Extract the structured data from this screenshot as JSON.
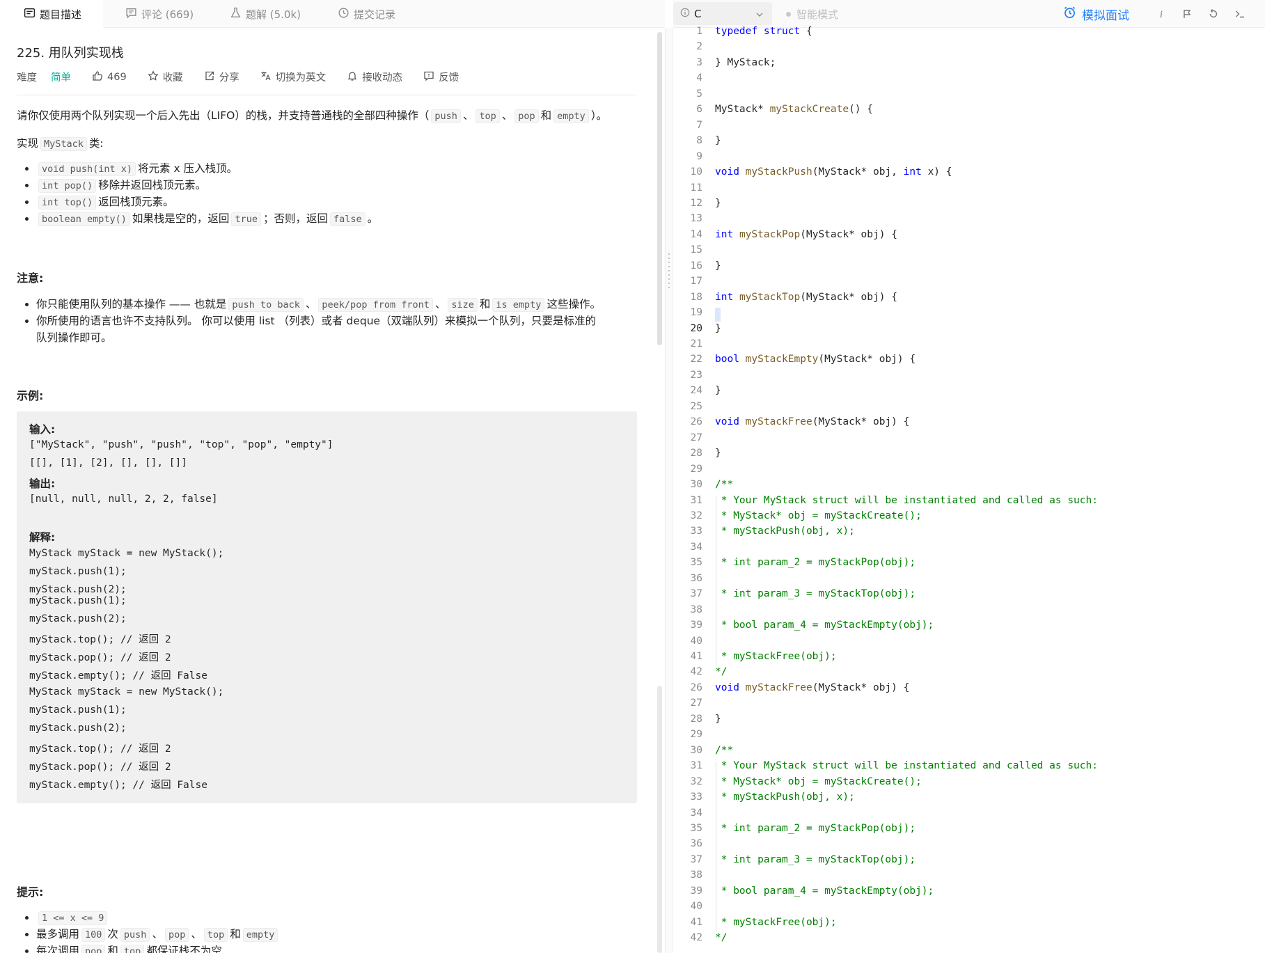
{
  "tabs": [
    {
      "label": "题目描述",
      "icon": "description-icon"
    },
    {
      "label": "评论 (669)",
      "icon": "comment-icon"
    },
    {
      "label": "题解 (5.0k)",
      "icon": "flask-icon"
    },
    {
      "label": "提交记录",
      "icon": "history-icon"
    }
  ],
  "problem": {
    "title": "225. 用队列实现栈",
    "difficulty_label": "难度",
    "difficulty_value": "简单",
    "likes": "469",
    "favorite": "收藏",
    "share": "分享",
    "switch_lang": "切换为英文",
    "subscribe": "接收动态",
    "feedback": "反馈",
    "intro_pre": "请你仅使用两个队列实现一个后入先出（LIFO）的栈，并支持普通栈的全部四种操作（",
    "intro_codes": [
      "push",
      "top",
      "pop",
      "empty"
    ],
    "intro_sep": "、",
    "intro_and": "和",
    "intro_post": "）。",
    "impl_pre": "实现",
    "impl_code": "MyStack",
    "impl_post": "类:",
    "methods": [
      {
        "code": "void push(int x)",
        "text": "将元素 x 压入栈顶。"
      },
      {
        "code": "int pop()",
        "text": "移除并返回栈顶元素。"
      },
      {
        "code": "int top()",
        "text": "返回栈顶元素。"
      },
      {
        "code": "boolean empty()",
        "text": "如果栈是空的，返回",
        "code2": "true",
        "text2": "；否则，返回",
        "code3": "false",
        "text3": "。"
      }
    ],
    "notice_heading": "注意:",
    "notice1_pre": "你只能使用队列的基本操作 —— 也就是",
    "notice1_codes": [
      "push to back",
      "peek/pop from front",
      "size",
      "is empty"
    ],
    "notice1_sep": "、",
    "notice1_and": "和",
    "notice1_post": "这些操作。",
    "notice2_line1": "你所使用的语言也许不支持队列。 你可以使用 list （列表）或者 deque（双端队列）来模拟一个队列，只要是标准的",
    "notice2_line2": "队列操作即可。",
    "example_heading": "示例:",
    "example_input_label": "输入:",
    "example_input_1": "[\"MyStack\", \"push\", \"push\", \"top\", \"pop\", \"empty\"]",
    "example_input_2": "[[], [1], [2], [], [], []]",
    "example_output_label": "输出:",
    "example_output": "[null, null, null, 2, 2, false]",
    "example_explain_label": "解释:",
    "example_explain": [
      "MyStack myStack = new MyStack();",
      "myStack.push(1);",
      "myStack.push(2);",
      "myStack.push(1);",
      "myStack.push(2);",
      "myStack.top(); // 返回 2",
      "myStack.pop(); // 返回 2",
      "myStack.empty(); // 返回 False",
      "MyStack myStack = new MyStack();",
      "myStack.push(1);",
      "myStack.push(2);",
      "myStack.top(); // 返回 2",
      "myStack.pop(); // 返回 2",
      "myStack.empty(); // 返回 False"
    ],
    "hints_heading": "提示:",
    "hint1_code": "1 <= x <= 9",
    "hint2_pre": "最多调用",
    "hint2_num": "100",
    "hint2_mid": "次",
    "hint2_codes": [
      "push",
      "pop",
      "top",
      "empty"
    ],
    "hint2_sep": "、",
    "hint2_and": "和",
    "hint3_pre": "每次调用",
    "hint3_code1": "pop",
    "hint3_and": "和",
    "hint3_code2": "top",
    "hint3_post": "都保证栈不为空"
  },
  "toolbar": {
    "language": "C",
    "smart_mode": "智能模式",
    "mock_interview": "模拟面试",
    "icons": [
      "info-icon",
      "run-icon",
      "reset-icon",
      "console-icon"
    ]
  },
  "editor": {
    "current_line": 20,
    "lines": [
      {
        "n": "1",
        "code": "typedef struct {"
      },
      {
        "n": "2",
        "code": ""
      },
      {
        "n": "3",
        "code": "} MyStack;"
      },
      {
        "n": "4",
        "code": ""
      },
      {
        "n": "5",
        "code": ""
      },
      {
        "n": "6",
        "code": "MyStack* myStackCreate() {"
      },
      {
        "n": "7",
        "code": ""
      },
      {
        "n": "8",
        "code": "}"
      },
      {
        "n": "9",
        "code": ""
      },
      {
        "n": "10",
        "code": "void myStackPush(MyStack* obj, int x) {"
      },
      {
        "n": "11",
        "code": ""
      },
      {
        "n": "12",
        "code": "}"
      },
      {
        "n": "13",
        "code": ""
      },
      {
        "n": "14",
        "code": "int myStackPop(MyStack* obj) {"
      },
      {
        "n": "15",
        "code": ""
      },
      {
        "n": "16",
        "code": "}"
      },
      {
        "n": "17",
        "code": ""
      },
      {
        "n": "18",
        "code": "int myStackTop(MyStack* obj) {"
      },
      {
        "n": "19",
        "code": ""
      },
      {
        "n": "20",
        "code": "}"
      },
      {
        "n": "21",
        "code": ""
      },
      {
        "n": "22",
        "code": "bool myStackEmpty(MyStack* obj) {"
      },
      {
        "n": "23",
        "code": ""
      },
      {
        "n": "24",
        "code": "}"
      },
      {
        "n": "25",
        "code": ""
      },
      {
        "n": "26",
        "code": "void myStackFree(MyStack* obj) {"
      },
      {
        "n": "27",
        "code": ""
      },
      {
        "n": "28",
        "code": "}"
      },
      {
        "n": "29",
        "code": ""
      },
      {
        "n": "30",
        "code": "/**"
      },
      {
        "n": "31",
        "code": " * Your MyStack struct will be instantiated and called as such:"
      },
      {
        "n": "32",
        "code": " * MyStack* obj = myStackCreate();"
      },
      {
        "n": "33",
        "code": " * myStackPush(obj, x);"
      },
      {
        "n": "34",
        "code": ""
      },
      {
        "n": "35",
        "code": " * int param_2 = myStackPop(obj);"
      },
      {
        "n": "36",
        "code": ""
      },
      {
        "n": "37",
        "code": " * int param_3 = myStackTop(obj);"
      },
      {
        "n": "38",
        "code": ""
      },
      {
        "n": "39",
        "code": " * bool param_4 = myStackEmpty(obj);"
      },
      {
        "n": "40",
        "code": ""
      },
      {
        "n": "41",
        "code": " * myStackFree(obj);"
      },
      {
        "n": "42",
        "code": "*/"
      },
      {
        "n": "26",
        "code": "void myStackFree(MyStack* obj) {"
      },
      {
        "n": "27",
        "code": ""
      },
      {
        "n": "28",
        "code": "}"
      },
      {
        "n": "29",
        "code": ""
      },
      {
        "n": "30",
        "code": "/**"
      },
      {
        "n": "31",
        "code": " * Your MyStack struct will be instantiated and called as such:"
      },
      {
        "n": "32",
        "code": " * MyStack* obj = myStackCreate();"
      },
      {
        "n": "33",
        "code": " * myStackPush(obj, x);"
      },
      {
        "n": "34",
        "code": ""
      },
      {
        "n": "35",
        "code": " * int param_2 = myStackPop(obj);"
      },
      {
        "n": "36",
        "code": ""
      },
      {
        "n": "37",
        "code": " * int param_3 = myStackTop(obj);"
      },
      {
        "n": "38",
        "code": ""
      },
      {
        "n": "39",
        "code": " * bool param_4 = myStackEmpty(obj);"
      },
      {
        "n": "40",
        "code": ""
      },
      {
        "n": "41",
        "code": " * myStackFree(obj);"
      },
      {
        "n": "42",
        "code": "*/"
      }
    ]
  }
}
